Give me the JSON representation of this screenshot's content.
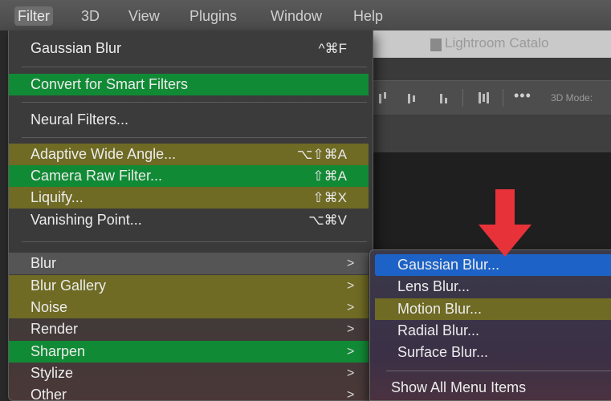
{
  "menubar": {
    "items": [
      "Filter",
      "3D",
      "View",
      "Plugins",
      "Window",
      "Help"
    ],
    "active": "Filter"
  },
  "background_app": {
    "tab_title": "Lightroom Catalo",
    "options_more": "•••",
    "options_3d_mode": "3D Mode:"
  },
  "filter_menu": {
    "items": [
      {
        "label": "Gaussian Blur",
        "shortcut": "^⌘F"
      },
      {
        "label": "Convert for Smart Filters",
        "shortcut": ""
      },
      {
        "label": "Neural Filters...",
        "shortcut": ""
      },
      {
        "label": "Adaptive Wide Angle...",
        "shortcut": "⌥⇧⌘A"
      },
      {
        "label": "Camera Raw Filter...",
        "shortcut": "⇧⌘A"
      },
      {
        "label": "Liquify...",
        "shortcut": "⇧⌘X"
      },
      {
        "label": "Vanishing Point...",
        "shortcut": "⌥⌘V"
      },
      {
        "label": "Blur",
        "submenu_chevron": ">"
      },
      {
        "label": "Blur Gallery",
        "submenu_chevron": ">"
      },
      {
        "label": "Noise",
        "submenu_chevron": ">"
      },
      {
        "label": "Render",
        "submenu_chevron": ">"
      },
      {
        "label": "Sharpen",
        "submenu_chevron": ">"
      },
      {
        "label": "Stylize",
        "submenu_chevron": ">"
      },
      {
        "label": "Other",
        "submenu_chevron": ">"
      }
    ]
  },
  "blur_submenu": {
    "items": [
      {
        "label": "Gaussian Blur..."
      },
      {
        "label": "Lens Blur..."
      },
      {
        "label": "Motion Blur..."
      },
      {
        "label": "Radial Blur..."
      },
      {
        "label": "Surface Blur..."
      }
    ],
    "show_all": "Show All Menu Items"
  },
  "colors": {
    "highlight_green": "#118a35",
    "highlight_olive": "#6f6a24",
    "highlight_blue": "#1d63c7",
    "arrow_red": "#e8323a"
  }
}
